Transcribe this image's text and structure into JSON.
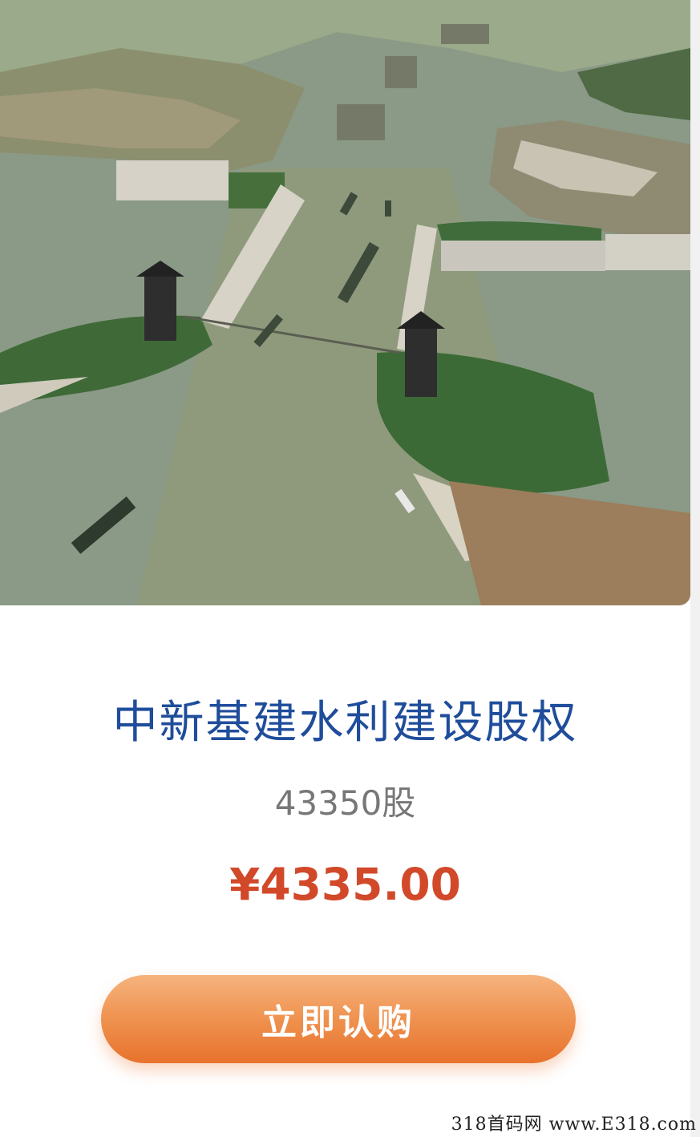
{
  "product": {
    "name": "中新基建水利建设股权",
    "shares": "43350股",
    "price": "¥4335.00"
  },
  "actions": {
    "buy_label": "立即认购"
  },
  "watermark": {
    "text": "318首码网  www.E318.com"
  },
  "colors": {
    "title": "#1f4d9b",
    "price": "#d2492a",
    "button": "#ee8a45"
  }
}
